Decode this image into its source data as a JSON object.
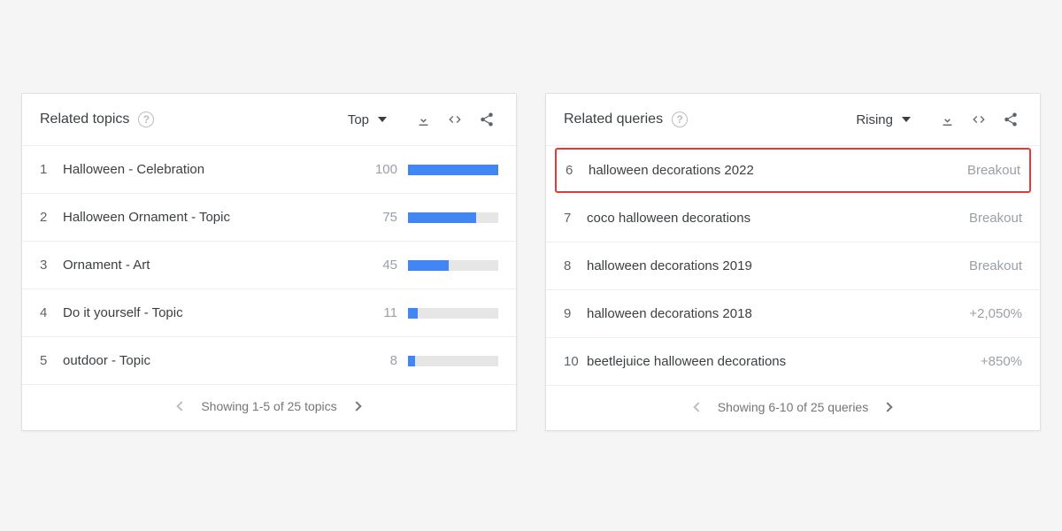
{
  "left": {
    "title": "Related topics",
    "sort": "Top",
    "items": [
      {
        "rank": "1",
        "label": "Halloween - Celebration",
        "value": "100",
        "pct": 100
      },
      {
        "rank": "2",
        "label": "Halloween Ornament - Topic",
        "value": "75",
        "pct": 75
      },
      {
        "rank": "3",
        "label": "Ornament - Art",
        "value": "45",
        "pct": 45
      },
      {
        "rank": "4",
        "label": "Do it yourself - Topic",
        "value": "11",
        "pct": 11
      },
      {
        "rank": "5",
        "label": "outdoor - Topic",
        "value": "8",
        "pct": 8
      }
    ],
    "pager": "Showing 1-5 of 25 topics"
  },
  "right": {
    "title": "Related queries",
    "sort": "Rising",
    "items": [
      {
        "rank": "6",
        "label": "halloween decorations 2022",
        "change": "Breakout",
        "highlight": true
      },
      {
        "rank": "7",
        "label": "coco halloween decorations",
        "change": "Breakout"
      },
      {
        "rank": "8",
        "label": "halloween decorations 2019",
        "change": "Breakout"
      },
      {
        "rank": "9",
        "label": "halloween decorations 2018",
        "change": "+2,050%"
      },
      {
        "rank": "10",
        "label": "beetlejuice halloween decorations",
        "change": "+850%"
      }
    ],
    "pager": "Showing 6-10 of 25 queries"
  }
}
